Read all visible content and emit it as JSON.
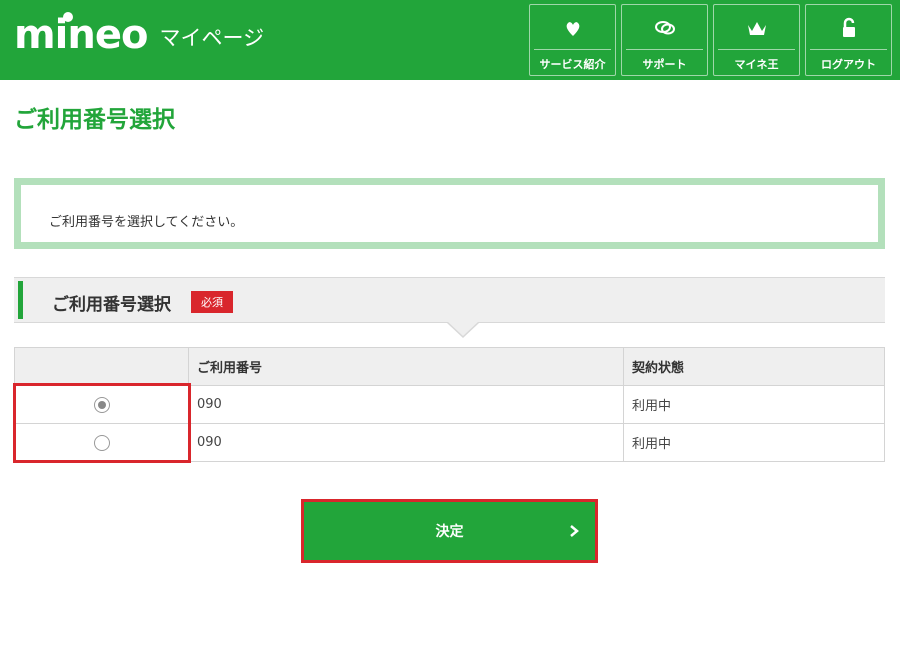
{
  "header": {
    "logo": "mineo",
    "logo_sub": "マイページ",
    "nav": [
      {
        "label": "サービス紹介",
        "icon": "heart-leaf-icon"
      },
      {
        "label": "サポート",
        "icon": "chat-bubbles-icon"
      },
      {
        "label": "マイネ王",
        "icon": "crown-icon"
      },
      {
        "label": "ログアウト",
        "icon": "unlock-icon"
      }
    ]
  },
  "page_title": "ご利用番号選択",
  "message": "ご利用番号を選択してください。",
  "section": {
    "title": "ご利用番号選択",
    "required_badge": "必須"
  },
  "table": {
    "headers": [
      "",
      "ご利用番号",
      "契約状態"
    ],
    "rows": [
      {
        "selected": true,
        "number": "090",
        "status": "利用中"
      },
      {
        "selected": false,
        "number": "090",
        "status": "利用中"
      }
    ]
  },
  "submit_label": "決定",
  "colors": {
    "brand_green": "#22a53a",
    "highlight_red": "#d9262c",
    "light_green_border": "#b3e0bb"
  }
}
